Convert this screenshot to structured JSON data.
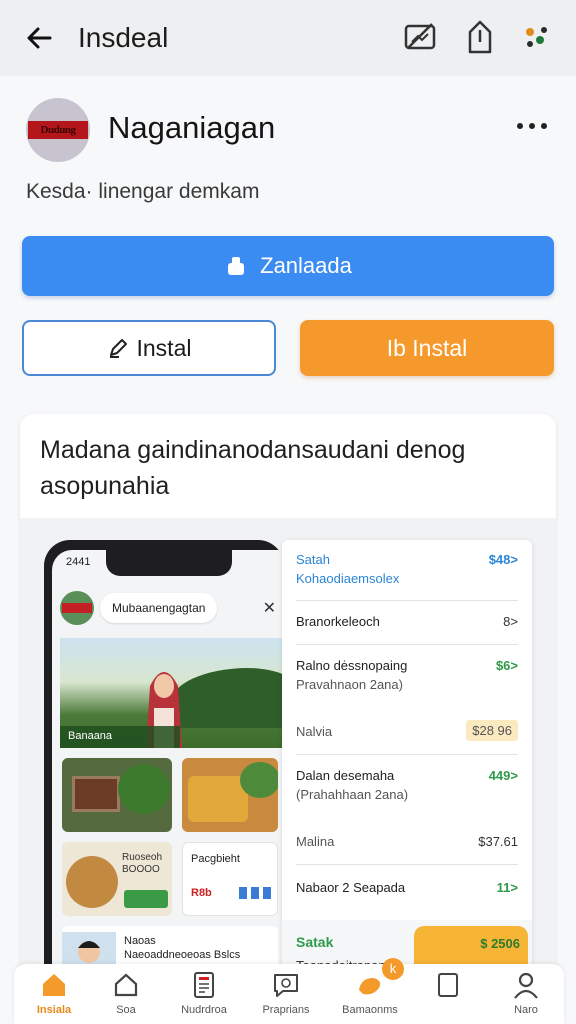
{
  "topbar": {
    "title": "Insdeal",
    "icons": [
      "back-arrow-icon",
      "cast-icon",
      "share-icon",
      "account-icon"
    ]
  },
  "app": {
    "name": "Naganiagan",
    "subtitle": "Kesda· linengar demkam",
    "icon_text": "Dudung"
  },
  "buttons": {
    "primary": "Zanlaada",
    "outline": "Instal",
    "orange": "Ib Instal"
  },
  "card": {
    "description": "Madana gaindinanodansaudani denog asopunahia",
    "phone": {
      "clock": "2441",
      "search": "Mubaanengagtan",
      "hero_caption": "Banaana",
      "tile3_text": "Ruoseoh BOOOO",
      "tile3_tag": "",
      "tile4_title": "Pacgbieht",
      "tile4_badge": "R8b",
      "tile5_title": "Naoas",
      "tile5_sub": "Naeoaddneoeoas Bslcs"
    },
    "panel": {
      "rows": [
        {
          "l1": "Satah",
          "l2": "Kohaodiaemsolex",
          "val": "$48>",
          "style": "blue"
        },
        {
          "l1": "Branorkeleoch",
          "l2": "",
          "val": "8>",
          "style": ""
        },
        {
          "l1": "Ralno dėssnopaing",
          "l2": "Pravahnaon 2ana)",
          "val": "$6>",
          "style": "green"
        },
        {
          "l1": "Nalvia",
          "l2": "",
          "val": "$28 96",
          "style": "pill"
        },
        {
          "l1": "Dalan desemaha",
          "l2": "(Prahahhaan 2ana)",
          "val": "449>",
          "style": "green"
        },
        {
          "l1": "Malina",
          "l2": "",
          "val": "$37.61",
          "style": ""
        },
        {
          "l1": "Nabaor 2 Seapada",
          "l2": "",
          "val": "11>",
          "style": "green"
        }
      ],
      "promo_title": "Satak",
      "promo_sub": "Taanadaitranan",
      "promo_val": "$ 2506"
    }
  },
  "nav": [
    {
      "label": "Insiala",
      "icon": "home-icon",
      "active": true
    },
    {
      "label": "Soa",
      "icon": "house-outline-icon",
      "active": false
    },
    {
      "label": "Nudrdroa",
      "icon": "document-icon",
      "active": false
    },
    {
      "label": "Praprians",
      "icon": "chat-icon",
      "active": false
    },
    {
      "label": "Bamaonms",
      "icon": "orange-blob-icon",
      "active": false
    },
    {
      "label": "",
      "icon": "tablet-icon",
      "active": false
    },
    {
      "label": "Naro",
      "icon": "person-icon",
      "active": false
    }
  ],
  "notification": "k",
  "colors": {
    "primary_blue": "#3b8cf2",
    "orange": "#f6992d",
    "green": "#2e9a4a"
  }
}
